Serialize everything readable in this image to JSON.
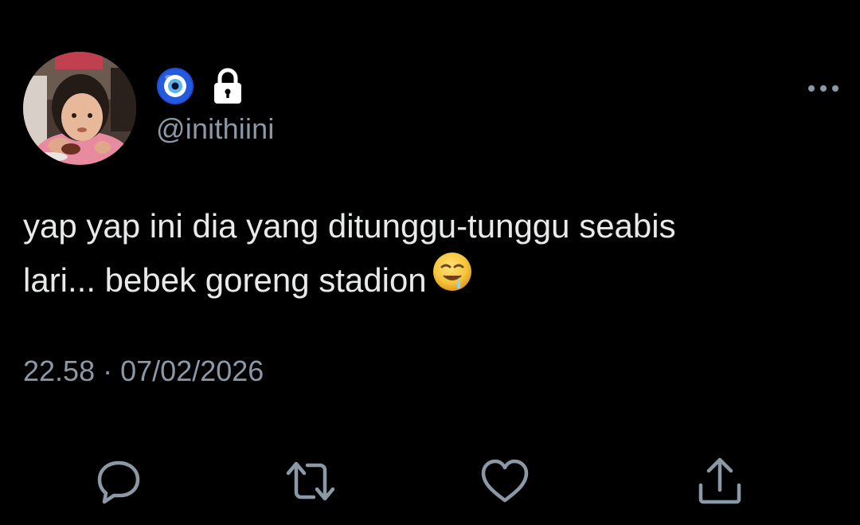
{
  "tweet": {
    "handle": "@inithiini",
    "text_line1": "yap yap ini dia yang ditunggu-tunggu seabis",
    "text_line2": "lari... bebek goreng stadion",
    "time": "22.58",
    "separator": "·",
    "date": "07/02/2026"
  },
  "icons": {
    "badge": "nazar-amulet-icon",
    "protected": "lock-icon",
    "more": "more-dots-icon",
    "emoji": "drooling-face-emoji",
    "reply": "reply-icon",
    "retweet": "retweet-icon",
    "like": "heart-icon",
    "share": "share-icon"
  },
  "colors": {
    "background": "#000000",
    "text": "#e7e9ea",
    "secondary": "#8b98a5"
  }
}
